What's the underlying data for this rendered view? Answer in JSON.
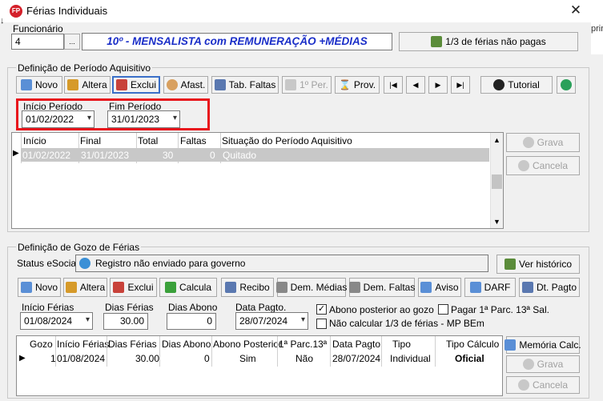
{
  "window": {
    "title": "Férias Individuais",
    "app_icon": "FP",
    "left_fragment": "↓",
    "right_fragment": "prin"
  },
  "employee": {
    "label": "Funcionário",
    "value": "4",
    "lookup_label": "...",
    "banner": "10º -  MENSALISTA com REMUNERAÇÃO +MÉDIAS",
    "unpaid_button": "1/3 de férias não pagas"
  },
  "acquisition": {
    "section_title": "Definição de Período Aquisitivo",
    "toolbar": {
      "new": "Novo",
      "edit": "Altera",
      "delete": "Exclui",
      "leave": "Afast.",
      "absence_table": "Tab. Faltas",
      "first_period": "1º Per.",
      "prov": "Prov.",
      "tutorial": "Tutorial"
    },
    "start_label": "Início Período",
    "start_value": "01/02/2022",
    "end_label": "Fim Período",
    "end_value": "31/01/2023",
    "columns": [
      "Início",
      "Final",
      "Total",
      "Faltas",
      "Situação do Período Aquisitivo"
    ],
    "rows": [
      {
        "start": "01/02/2022",
        "end": "31/01/2023",
        "total": "30",
        "absences": "0",
        "status": "Quitado"
      }
    ],
    "save_button": "Grava",
    "cancel_button": "Cancela"
  },
  "enjoyment": {
    "section_title": "Definição de Gozo de Férias",
    "status_label": "Status eSocial:",
    "status_value": "Registro não enviado para governo",
    "history_button": "Ver histórico",
    "toolbar": {
      "new": "Novo",
      "edit": "Altera",
      "delete": "Exclui",
      "calculate": "Calcula",
      "receipt": "Recibo",
      "avg_stmt": "Dem. Médias",
      "absence_stmt": "Dem. Faltas",
      "notice": "Aviso",
      "darf": "DARF",
      "pay_date": "Dt. Pagto"
    },
    "start_label": "Início Férias",
    "start_value": "01/08/2024",
    "days_label": "Dias Férias",
    "days_value": "30.00",
    "bonus_days_label": "Dias Abono",
    "bonus_days_value": "0",
    "pay_date_label": "Data Pagto.",
    "pay_date_value": "28/07/2024",
    "checks": {
      "abono_posterior": {
        "label": "Abono posterior ao gozo",
        "checked": true
      },
      "nao_calcular": {
        "label": "Não calcular 1/3 de férias - MP BEm",
        "checked": false
      },
      "pagar_13": {
        "label": "Pagar 1ª Parc. 13ª Sal.",
        "checked": false
      }
    },
    "columns": [
      "Gozo",
      "Início Férias",
      "Dias Férias",
      "Dias Abono",
      "Abono Posterior",
      "1ª Parc.13ª",
      "Data Pagto",
      "Tipo",
      "Tipo Cálculo"
    ],
    "rows": [
      {
        "gozo": "1",
        "start": "01/08/2024",
        "days": "30.00",
        "bonus": "0",
        "after": "Sim",
        "parc13": "Não",
        "pay": "28/07/2024",
        "type": "Individual",
        "calc_type": "Oficial"
      }
    ],
    "memory_button": "Memória Calc.",
    "save_button": "Grava",
    "cancel_button": "Cancela"
  },
  "colors": {
    "highlight_box": "#e8141c",
    "banner_text": "#1a2ec8",
    "selected_row": "#c8c8c8"
  }
}
